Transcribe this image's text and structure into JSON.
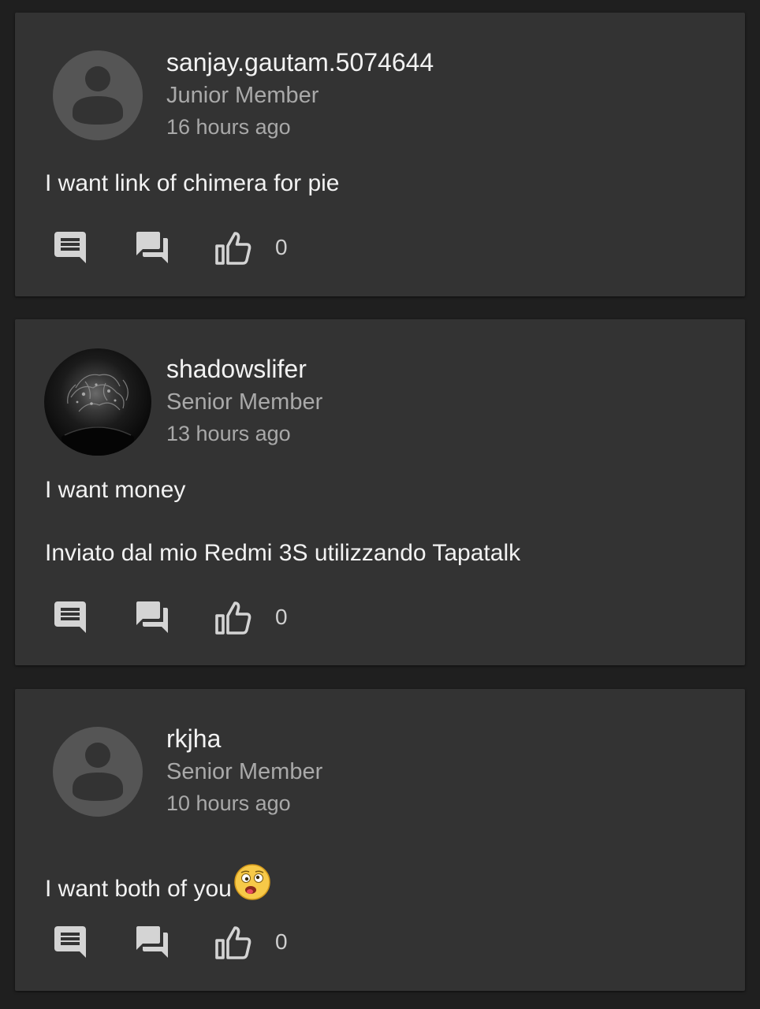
{
  "posts": [
    {
      "username": "sanjay.gautam.5074644",
      "rank": "Junior Member",
      "time": "16 hours ago",
      "avatar": "default-person-icon",
      "body": [
        "I want link of chimera for pie"
      ],
      "like_count": "0"
    },
    {
      "username": "shadowslifer",
      "rank": "Senior Member",
      "time": "13 hours ago",
      "avatar": "user-photo",
      "body": [
        "I want money",
        "Inviato dal mio Redmi 3S utilizzando Tapatalk"
      ],
      "like_count": "0"
    },
    {
      "username": "rkjha",
      "rank": "Senior Member",
      "time": "10 hours ago",
      "avatar": "default-person-icon",
      "body": [
        "I want both of you"
      ],
      "emoji": "drooling-dizzy-face-emoji",
      "like_count": "0"
    }
  ],
  "icons": {
    "comment": "comment-icon",
    "reply": "forum-reply-icon",
    "like": "thumbs-up-icon"
  },
  "colors": {
    "background": "#1f1f1f",
    "card": "#333333",
    "primary_text": "#f2f2f2",
    "secondary_text": "#a9a9a9",
    "icon": "#d4d4d4"
  }
}
